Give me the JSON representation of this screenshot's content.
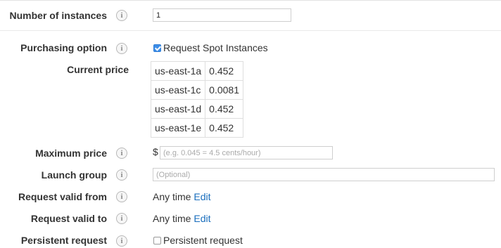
{
  "fields": {
    "instances": {
      "label": "Number of instances",
      "value": "1"
    },
    "purchasing": {
      "label": "Purchasing option",
      "checkbox_label": "Request Spot Instances",
      "checked": true
    },
    "current_price": {
      "label": "Current price",
      "rows": [
        {
          "zone": "us-east-1a",
          "price": "0.452"
        },
        {
          "zone": "us-east-1c",
          "price": "0.0081"
        },
        {
          "zone": "us-east-1d",
          "price": "0.452"
        },
        {
          "zone": "us-east-1e",
          "price": "0.452"
        }
      ]
    },
    "max_price": {
      "label": "Maximum price",
      "currency": "$",
      "placeholder": "(e.g. 0.045 = 4.5 cents/hour)"
    },
    "launch_group": {
      "label": "Launch group",
      "placeholder": "(Optional)"
    },
    "valid_from": {
      "label": "Request valid from",
      "value": "Any time",
      "edit": "Edit"
    },
    "valid_to": {
      "label": "Request valid to",
      "value": "Any time",
      "edit": "Edit"
    },
    "persistent": {
      "label": "Persistent request",
      "checkbox_label": "Persistent request",
      "checked": false
    }
  },
  "info_icon_glyph": "i",
  "colors": {
    "link": "#1a6ebd",
    "checkbox_checked": "#3d8ee8"
  }
}
